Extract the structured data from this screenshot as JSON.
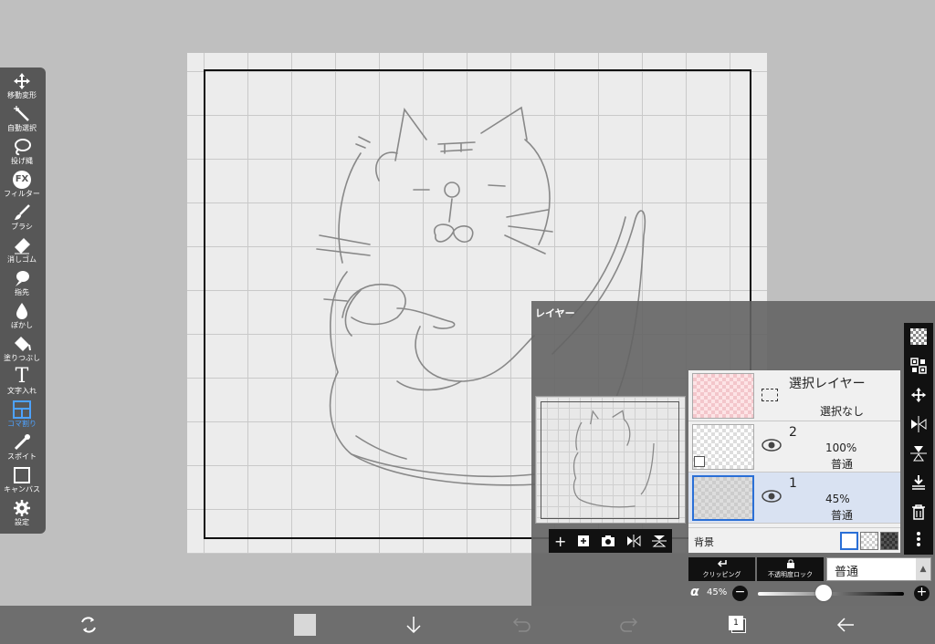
{
  "toolbar": {
    "items": [
      {
        "label": "移動変形",
        "icon": "move-icon"
      },
      {
        "label": "自動選択",
        "icon": "magic-wand-icon"
      },
      {
        "label": "投げ縄",
        "icon": "lasso-icon"
      },
      {
        "label": "フィルター",
        "icon": "fx-filter-icon"
      },
      {
        "label": "ブラシ",
        "icon": "brush-icon"
      },
      {
        "label": "消しゴム",
        "icon": "eraser-icon"
      },
      {
        "label": "指先",
        "icon": "smudge-icon"
      },
      {
        "label": "ぼかし",
        "icon": "blur-drop-icon"
      },
      {
        "label": "塗りつぶし",
        "icon": "fill-bucket-icon"
      },
      {
        "label": "文字入れ",
        "icon": "text-icon"
      },
      {
        "label": "コマ割り",
        "icon": "frame-divider-icon"
      },
      {
        "label": "スポイト",
        "icon": "eyedropper-icon"
      },
      {
        "label": "キャンバス",
        "icon": "canvas-icon"
      },
      {
        "label": "設定",
        "icon": "gear-icon"
      }
    ],
    "active_index": 10
  },
  "fx_glyph": "FX",
  "text_glyph": "T",
  "layer_panel": {
    "title": "レイヤー",
    "selection_layer": {
      "name": "選択レイヤー",
      "status": "選択なし"
    },
    "layers": [
      {
        "number": "2",
        "opacity": "100%",
        "blend": "普通",
        "selected": false
      },
      {
        "number": "1",
        "opacity": "45%",
        "blend": "普通",
        "selected": true
      }
    ],
    "background_label": "背景",
    "clipping_label": "クリッピング",
    "lock_label": "不透明度ロック",
    "blend_mode": "普通",
    "alpha_symbol": "α",
    "alpha_value": "45%",
    "alpha_fraction": 0.45,
    "minus": "−",
    "plus": "+",
    "thumb_tools": [
      "add-layer-icon",
      "add-layer-copy-icon",
      "camera-icon",
      "flip-horizontal-icon",
      "flip-vertical-icon"
    ],
    "side_tools": [
      "transparency-icon",
      "qr-icon",
      "move-icon",
      "flip-horizontal-icon",
      "flip-vertical-icon",
      "merge-down-icon",
      "trash-icon",
      "more-icon"
    ]
  },
  "bottom_bar": {
    "page_badge": "1",
    "icons": [
      "transform-rotate-icon",
      "color-swatch",
      "download-arrow-icon",
      "undo-icon",
      "redo-icon",
      "layers-icon",
      "back-arrow-icon"
    ]
  },
  "colors": {
    "accent": "#2a6fd6",
    "toolbar_bg": "#575757",
    "active_tool": "#4da2ff"
  }
}
